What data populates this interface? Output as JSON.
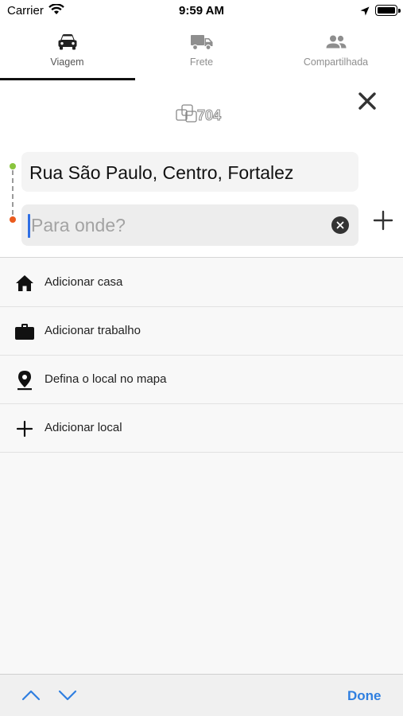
{
  "status_bar": {
    "carrier": "Carrier",
    "time": "9:59 AM"
  },
  "tabs": [
    {
      "label": "Viagem",
      "icon": "car-icon",
      "active": true
    },
    {
      "label": "Frete",
      "icon": "truck-icon",
      "active": false
    },
    {
      "label": "Compartilhada",
      "icon": "people-icon",
      "active": false
    }
  ],
  "logo_text": "704",
  "route": {
    "origin": "Rua São Paulo, Centro, Fortalez",
    "destination_value": "",
    "destination_placeholder": "Para onde?"
  },
  "shortcuts": [
    {
      "label": "Adicionar casa",
      "icon": "home-icon"
    },
    {
      "label": "Adicionar trabalho",
      "icon": "briefcase-icon"
    },
    {
      "label": "Defina o local no mapa",
      "icon": "map-pin-icon"
    },
    {
      "label": "Adicionar local",
      "icon": "plus-icon"
    }
  ],
  "keyboard_toolbar": {
    "done_label": "Done"
  },
  "colors": {
    "accent_blue": "#2f7fe0",
    "origin_dot": "#8ac53e",
    "destination_dot": "#ea5b1e",
    "tab_indicator": "#111111"
  }
}
